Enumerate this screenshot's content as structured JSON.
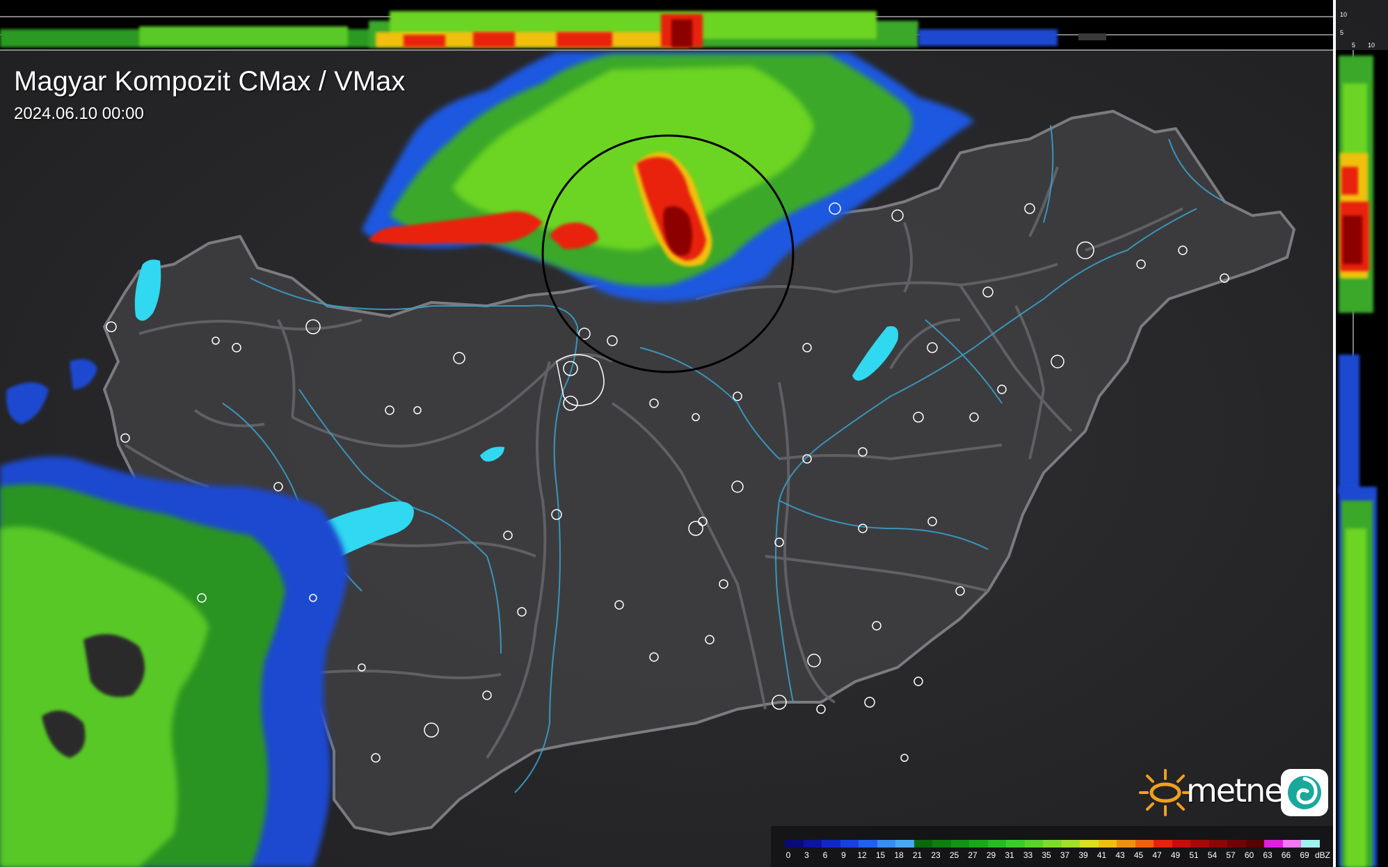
{
  "title": "Magyar Kompozit CMax / VMax",
  "timestamp": "2024.06.10 00:00",
  "logo": {
    "text": "metnet"
  },
  "top_profile_axis": [
    "10",
    "5"
  ],
  "side_profile_axis": [
    "5",
    "10"
  ],
  "legend": {
    "unit": "dBZ",
    "labels": [
      "0",
      "3",
      "6",
      "9",
      "12",
      "15",
      "18",
      "21",
      "23",
      "25",
      "27",
      "29",
      "31",
      "33",
      "35",
      "37",
      "39",
      "41",
      "43",
      "45",
      "47",
      "49",
      "51",
      "54",
      "57",
      "60",
      "63",
      "66",
      "69"
    ],
    "colors": [
      "#0a0a78",
      "#0c14a0",
      "#1028c8",
      "#1840e0",
      "#2060f0",
      "#3a8cf5",
      "#4aa8f0",
      "#0a6a0a",
      "#0e7e0e",
      "#149414",
      "#1aa81a",
      "#26bc26",
      "#3ccc2a",
      "#5ad42c",
      "#7cdc2c",
      "#a0e02a",
      "#d8e020",
      "#f0c010",
      "#f09010",
      "#f06010",
      "#e82010",
      "#c80c0c",
      "#a80808",
      "#8c0606",
      "#700404",
      "#580202",
      "#e020e0",
      "#f078f0",
      "#a0f0f0"
    ]
  },
  "colors": {
    "background": "#2a2a2c",
    "country": "#3d3d40",
    "border": "#7a7a7e",
    "rivers": "#3a9ec8",
    "lakes": "#30d8f0",
    "marker_circle": "#000000"
  }
}
